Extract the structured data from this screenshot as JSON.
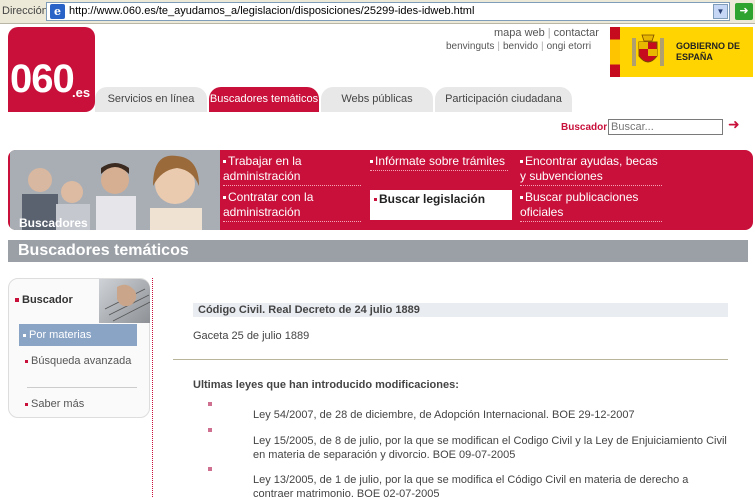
{
  "browser": {
    "address_label": "Dirección",
    "url": "http://www.060.es/te_ayudamos_a/legislacion/disposiciones/25299-ides-idweb.html",
    "ie_glyph": "e"
  },
  "header": {
    "logo_number": "060",
    "logo_suffix": ".es",
    "top_links": [
      "mapa web",
      "contactar"
    ],
    "language_links": [
      "benvinguts",
      "benvido",
      "ongi etorri"
    ],
    "gov_name": "GOBIERNO DE ESPAÑA",
    "nav_tabs": [
      {
        "label": "Servicios en línea",
        "active": false
      },
      {
        "label": "Buscadores temáticos",
        "active": true
      },
      {
        "label": "Webs públicas",
        "active": false
      },
      {
        "label": "Participación ciudadana",
        "active": false
      }
    ],
    "search": {
      "label": "Buscador",
      "placeholder": "Buscar...",
      "go_glyph": "➜"
    }
  },
  "banner": {
    "title": "Buscadores",
    "links": [
      {
        "label": "Trabajar en la administración",
        "active": false
      },
      {
        "label": "Infórmate sobre trámites",
        "active": false
      },
      {
        "label": "Encontrar ayudas, becas y subvenciones",
        "active": false
      },
      {
        "label": "Contratar con la administración",
        "active": false
      },
      {
        "label": "Buscar legislación",
        "active": true
      },
      {
        "label": "Buscar publicaciones oficiales",
        "active": false
      }
    ]
  },
  "section": {
    "title": "Buscadores temáticos"
  },
  "sidebar": {
    "heading": "Buscador",
    "items": [
      {
        "label": "Por materias",
        "active": true
      },
      {
        "label": "Búsqueda avanzada",
        "active": false
      },
      {
        "label": "Saber más",
        "active": false
      }
    ]
  },
  "content": {
    "law_title": "Código Civil. Real Decreto de 24 julio 1889",
    "gaceta": "Gaceta 25 de julio 1889",
    "mods_title": "Ultimas leyes que han introducido modificaciones:",
    "modifications": [
      "Ley 54/2007, de 28 de diciembre, de Adopción Internacional. BOE 29-12-2007",
      "Ley 15/2005, de 8 de julio, por la que se modifican el Codigo Civil y la Ley de Enjuiciamiento Civil en materia de separación y divorcio. BOE 09-07-2005",
      "Ley 13/2005, de 1 de julio, por la que se modifica el Código Civil en materia de derecho a contraer matrimonio. BOE 02-07-2005"
    ]
  },
  "colors": {
    "brand_red": "#c8103a",
    "section_gray": "#9ba0a6",
    "active_blue": "#8aa4c6",
    "gov_yellow": "#ffd400"
  }
}
